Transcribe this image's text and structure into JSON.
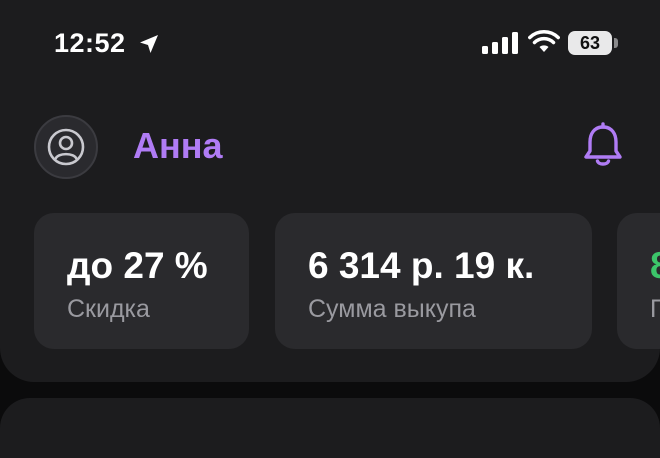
{
  "status_bar": {
    "time": "12:52",
    "battery": "63"
  },
  "header": {
    "user_name": "Анна"
  },
  "stats": [
    {
      "value": "до 27 %",
      "label": "Скидка"
    },
    {
      "value": "6 314 р.  19 к.",
      "label": "Сумма выкупа"
    },
    {
      "value": "8",
      "label": "П"
    }
  ],
  "colors": {
    "accent": "#b07cf5",
    "positive": "#3cc56a",
    "panel": "#1c1c1e",
    "card": "#2a2a2d"
  },
  "icons": [
    "location-arrow-icon",
    "signal-icon",
    "wifi-icon",
    "battery-icon",
    "user-avatar-icon",
    "bell-icon"
  ]
}
